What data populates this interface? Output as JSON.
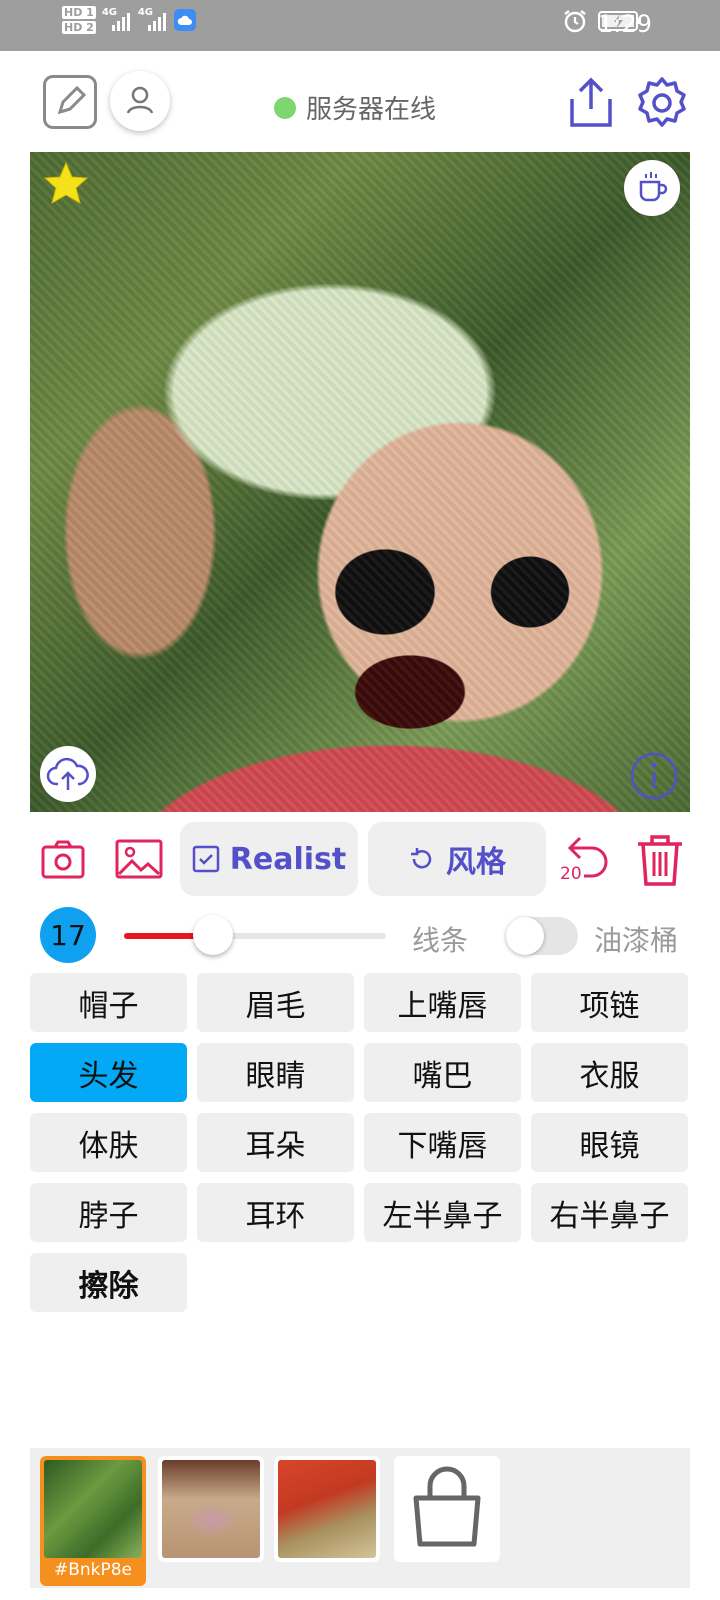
{
  "status_bar": {
    "hd1": "HD 1",
    "hd2": "HD 2",
    "net1": "4G",
    "net2": "4G",
    "time": "1:29",
    "icons": [
      "alarm-icon",
      "battery-charging-icon",
      "cloud-app-icon"
    ]
  },
  "header": {
    "server_status": "服务器在线",
    "server_status_color": "#7ed66f",
    "icons": [
      "edit-icon",
      "user-icon",
      "share-icon",
      "gear-icon"
    ]
  },
  "canvas": {
    "icons": [
      "star-icon",
      "coffee-cup-icon",
      "cloud-upload-icon",
      "info-icon"
    ]
  },
  "toolbar": {
    "realist_label": "Realist",
    "style_label": "风格",
    "undo_count": "20",
    "accent_color": "#5350c9",
    "danger_color": "#e0245e"
  },
  "brush": {
    "size": "17",
    "level": 0.34,
    "lines_label": "线条",
    "bucket_label": "油漆桶",
    "bucket_enabled": false
  },
  "parts": [
    {
      "label": "帽子",
      "active": false
    },
    {
      "label": "眉毛",
      "active": false
    },
    {
      "label": "上嘴唇",
      "active": false
    },
    {
      "label": "项链",
      "active": false
    },
    {
      "label": "头发",
      "active": true
    },
    {
      "label": "眼睛",
      "active": false
    },
    {
      "label": "嘴巴",
      "active": false
    },
    {
      "label": "衣服",
      "active": false
    },
    {
      "label": "体肤",
      "active": false
    },
    {
      "label": "耳朵",
      "active": false
    },
    {
      "label": "下嘴唇",
      "active": false
    },
    {
      "label": "眼镜",
      "active": false
    },
    {
      "label": "脖子",
      "active": false
    },
    {
      "label": "耳环",
      "active": false
    },
    {
      "label": "左半鼻子",
      "active": false
    },
    {
      "label": "右半鼻子",
      "active": false
    }
  ],
  "erase_label": "擦除",
  "gallery": {
    "selected_tag": "#BnkP8e",
    "icons": [
      "shopping-bag-icon"
    ]
  }
}
